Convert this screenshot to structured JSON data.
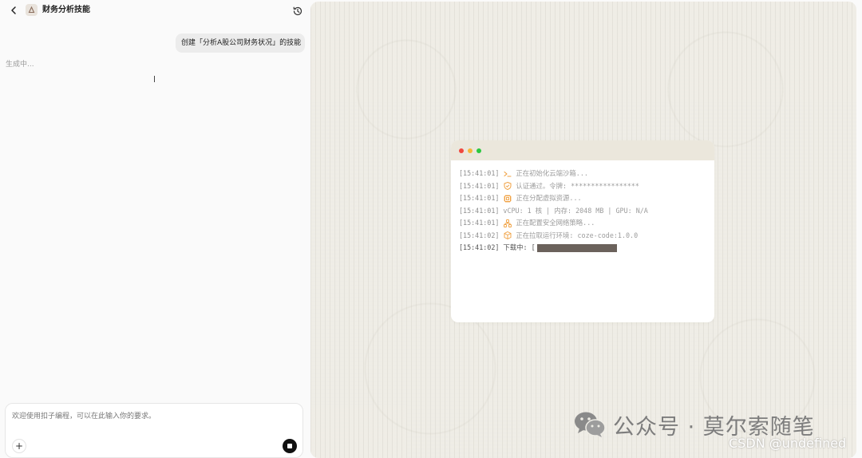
{
  "header": {
    "title": "财务分析技能",
    "back_icon": "chevron-left-icon",
    "app_icon": "skill-icon",
    "history_icon": "history-icon"
  },
  "chat": {
    "user_message": "创建「分析A股公司财务状况」的技能",
    "status": "生成中..."
  },
  "composer": {
    "placeholder": "欢迎使用扣子编程，可以在此输入你的要求。",
    "value": "",
    "add_icon": "plus-icon",
    "stop_icon": "stop-icon"
  },
  "terminal": {
    "dots": [
      "#f0483e",
      "#f5b83b",
      "#2bc840"
    ],
    "accent": "#f0a040",
    "lines": [
      {
        "time": "[15:41:01]",
        "icon": "terminal-prompt-icon",
        "text": "正在初始化云端沙箱..."
      },
      {
        "time": "[15:41:01]",
        "icon": "shield-icon",
        "text": "认证通过。令牌: *****************"
      },
      {
        "time": "[15:41:01]",
        "icon": "cpu-icon",
        "text": "正在分配虚拟资源..."
      },
      {
        "time": "[15:41:01]",
        "icon": "",
        "text": "vCPU: 1 核 | 内存: 2048 MB | GPU: N/A"
      },
      {
        "time": "[15:41:01]",
        "icon": "network-icon",
        "text": "正在配置安全网络策略..."
      },
      {
        "time": "[15:41:02]",
        "icon": "package-icon",
        "text": "正在拉取运行环境: coze-code:1.0.0"
      }
    ],
    "download": {
      "time": "[15:41:02]",
      "label": "下载中: ["
    }
  },
  "watermark": {
    "text": "公众号 · 莫尔索随笔",
    "csdn": "CSDN @undefined"
  }
}
